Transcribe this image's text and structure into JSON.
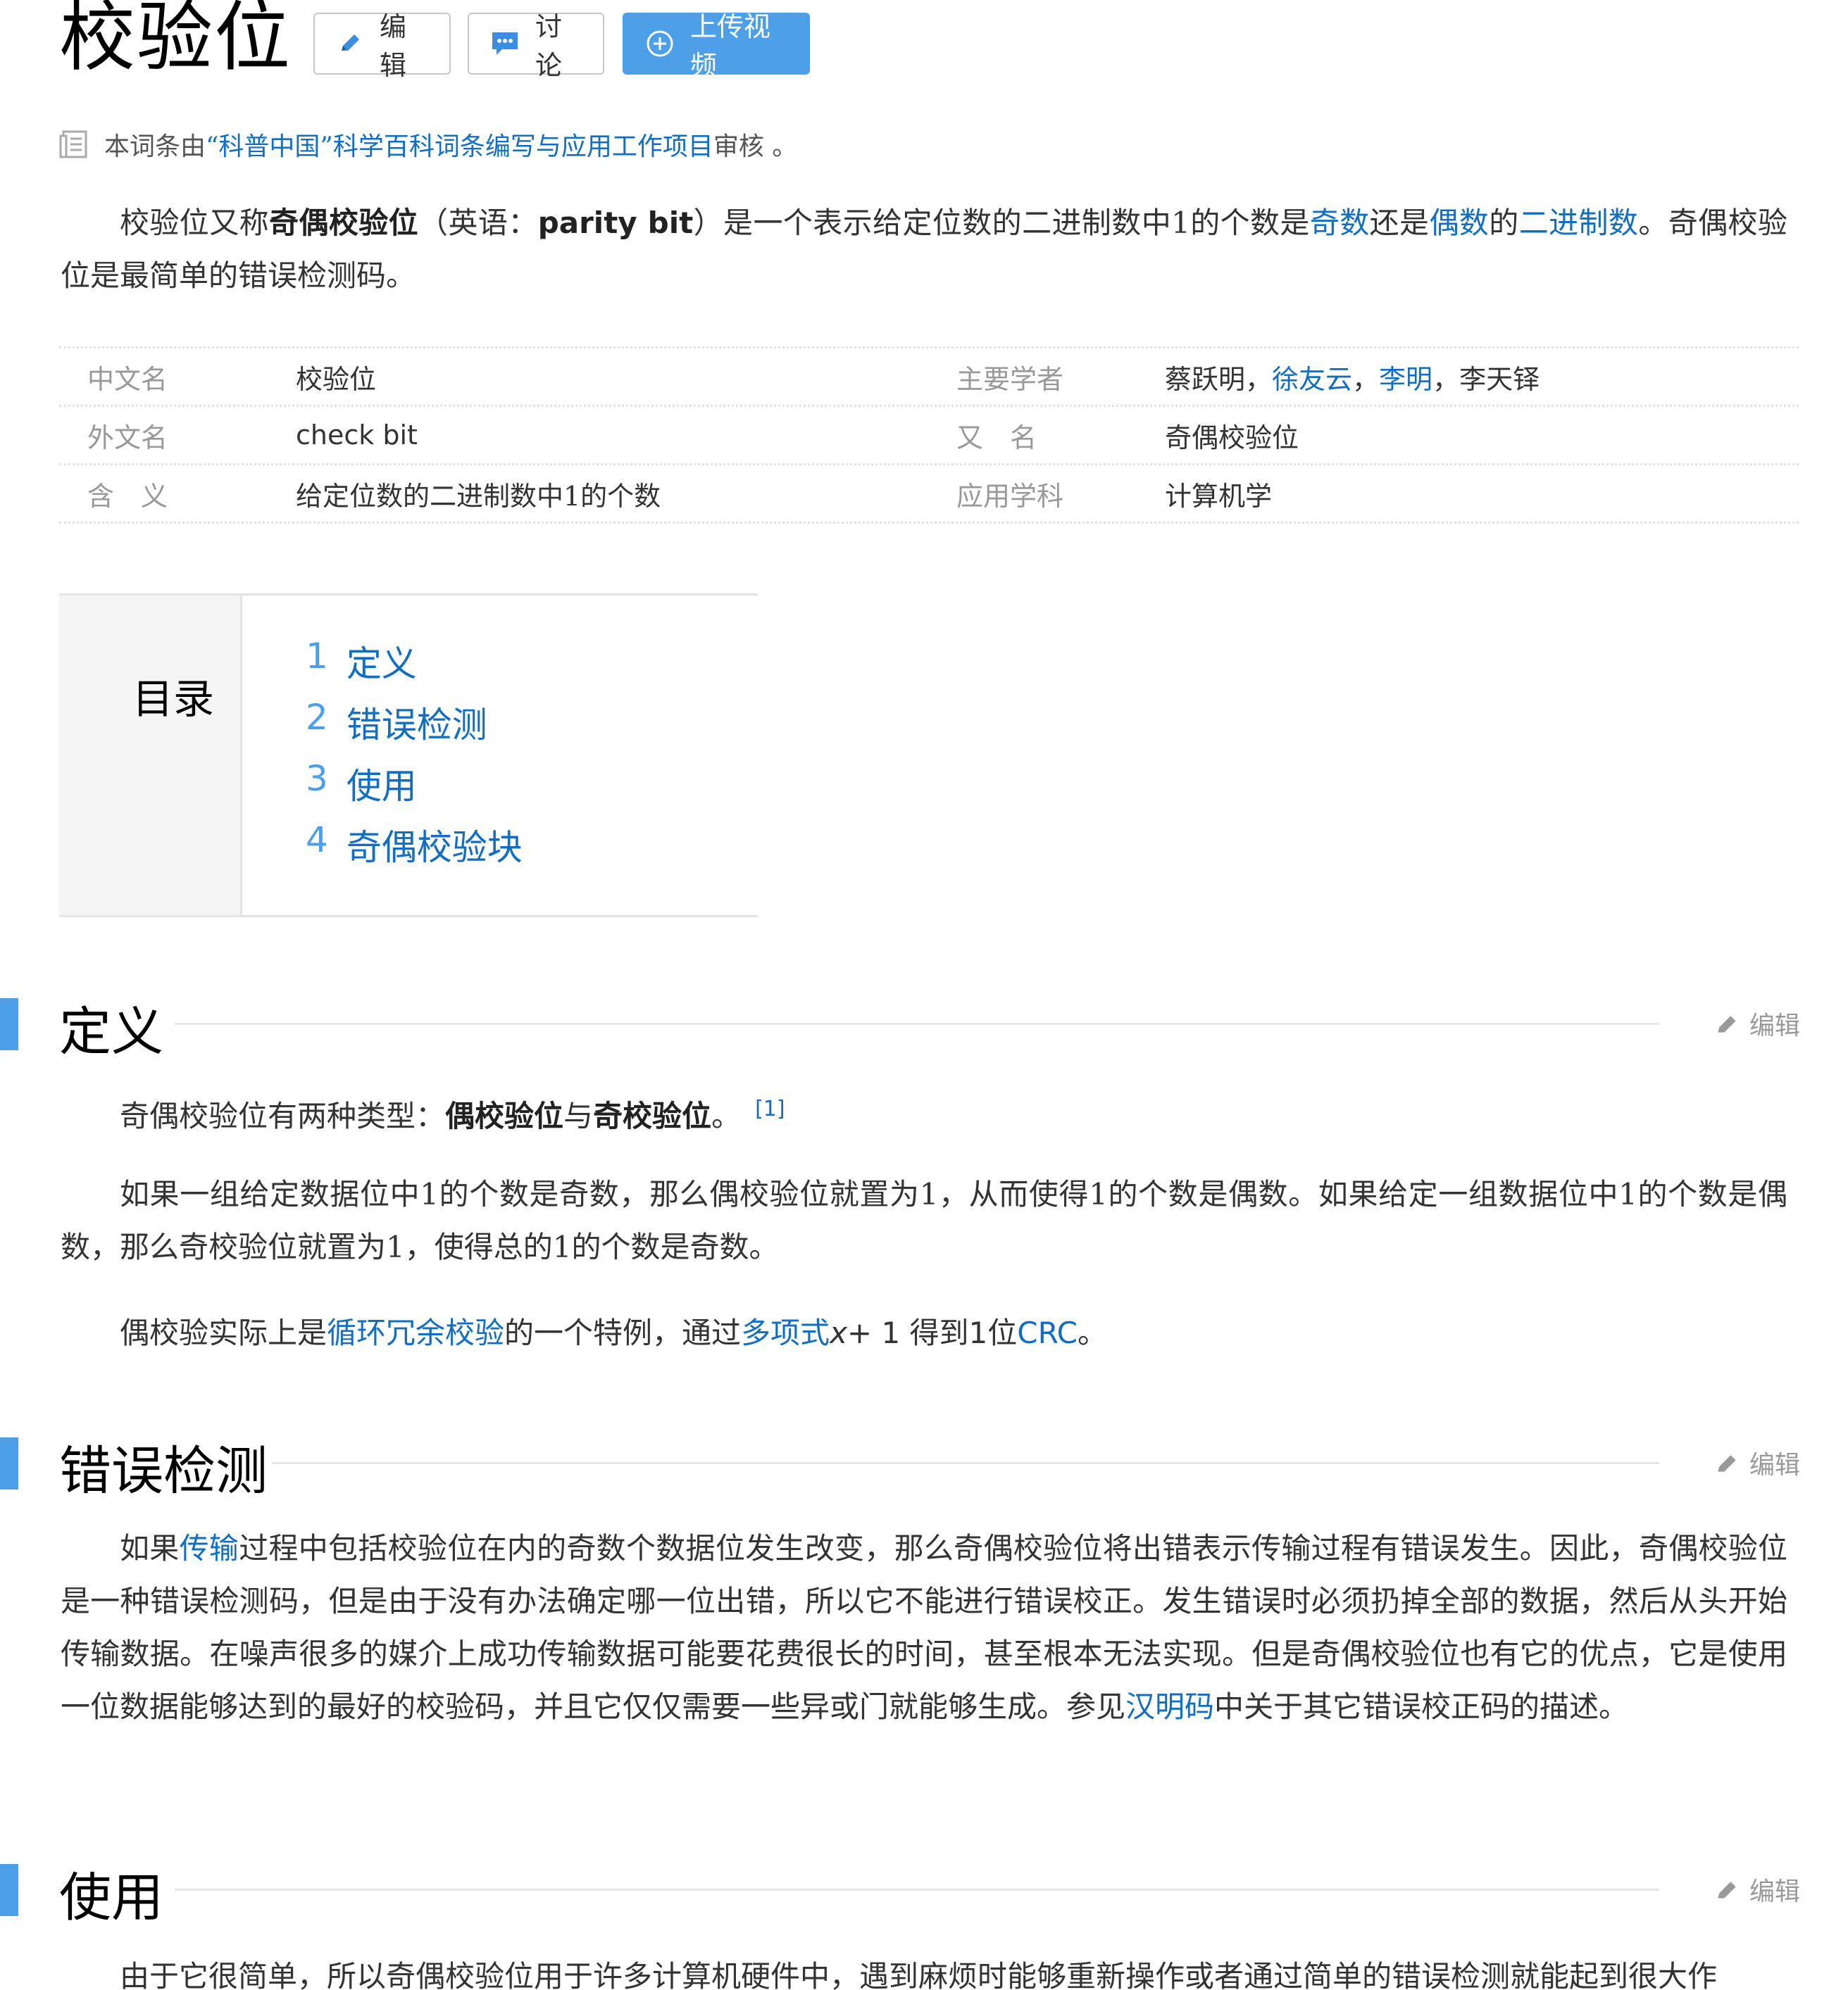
{
  "header": {
    "title": "校验位",
    "edit_label": "编辑",
    "discuss_label": "讨论",
    "upload_label": "上传视频"
  },
  "notice": {
    "prefix": "本词条由",
    "link": "“科普中国”科学百科词条编写与应用工作项目",
    "suffix": " 审核 。"
  },
  "intro": {
    "t1": "校验位又称",
    "b1": "奇偶校验位",
    "t2": "（英语：",
    "b2": "parity bit",
    "t3": "）是一个表示给定位数的二进制数中1的个数是",
    "l1": "奇数",
    "t4": "还是",
    "l2": "偶数",
    "t5": "的",
    "l3": "二进制数",
    "t6": "。奇偶校验位是最简单的错误检测码。"
  },
  "infobox": {
    "rows": [
      {
        "k1": "中文名",
        "v1": "校验位",
        "k2": "主要学者"
      },
      {
        "k1": "外文名",
        "v1": "check bit",
        "k2": "又　名",
        "v2": "奇偶校验位"
      },
      {
        "k1": "含　义",
        "v1": "给定位数的二进制数中1的个数",
        "k2": "应用学科",
        "v2": "计算机学"
      }
    ],
    "scholars": {
      "p1": "蔡跃明，",
      "l1": "徐友云",
      "s1": "，",
      "l2": "李明",
      "s2": "，",
      "p2": "李天铎"
    }
  },
  "catalog": {
    "title": "目录",
    "items": [
      {
        "num": "1",
        "label": "定义"
      },
      {
        "num": "2",
        "label": "错误检测"
      },
      {
        "num": "3",
        "label": "使用"
      },
      {
        "num": "4",
        "label": "奇偶校验块"
      }
    ]
  },
  "sections": {
    "edit_label": "编辑",
    "definition": {
      "title": "定义",
      "p1_a": "奇偶校验位有两种类型：",
      "p1_b": "偶校验位",
      "p1_c": "与",
      "p1_d": "奇校验位",
      "p1_e": "。",
      "p1_ref": "[1]",
      "p2": "如果一组给定数据位中1的个数是奇数，那么偶校验位就置为1，从而使得1的个数是偶数。如果给定一组数据位中1的个数是偶数，那么奇校验位就置为1，使得总的1的个数是奇数。",
      "p3_a": "偶校验实际上是",
      "p3_l1": "循环冗余校验",
      "p3_b": "的一个特例，通过",
      "p3_l2": "多项式",
      "p3_x": "x",
      "p3_c": "+ 1 得到1位",
      "p3_l3": "CRC",
      "p3_d": "。"
    },
    "error_detection": {
      "title": "错误检测",
      "a": "如果",
      "l1": "传输",
      "b": "过程中包括校验位在内的奇数个数据位发生改变，那么奇偶校验位将出错表示传输过程有错误发生。因此，奇偶校验位是一种错误检测码，但是由于没有办法确定哪一位出错，所以它不能进行错误校正。发生错误时必须扔掉全部的数据，然后从头开始传输数据。在噪声很多的媒介上成功传输数据可能要花费很长的时间，甚至根本无法实现。但是奇偶校验位也有它的优点，它是使用一位数据能够达到的最好的校验码，并且它仅仅需要一些异或门就能够生成。参见",
      "l2": "汉明码",
      "c": "中关于其它错误校正码的描述。"
    },
    "usage": {
      "title": "使用",
      "p1": "由于它很简单，所以奇偶校验位用于许多计算机硬件中，遇到麻烦时能够重新操作或者通过简单的错误检测就能起到很大作"
    }
  },
  "icons": [
    "pencil-icon",
    "chat-icon",
    "plus-circle-icon",
    "document-icon"
  ],
  "colors": {
    "link": "#136ec2",
    "accent": "#4d9fe8"
  }
}
